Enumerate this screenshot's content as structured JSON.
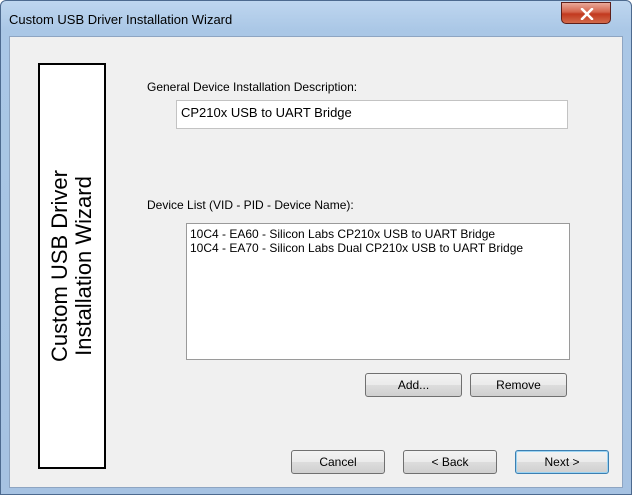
{
  "window": {
    "title": "Custom USB Driver Installation Wizard",
    "close_glyph": "x"
  },
  "side_panel": {
    "line1": "Custom USB Driver",
    "line2": "Installation Wizard"
  },
  "description": {
    "label": "General Device Installation Description:",
    "value": "CP210x USB to UART Bridge"
  },
  "device_list": {
    "label": "Device List (VID - PID - Device Name):",
    "items": [
      "10C4 - EA60 - Silicon Labs CP210x USB to UART Bridge",
      "10C4 - EA70 - Silicon Labs Dual CP210x USB to UART Bridge"
    ]
  },
  "buttons": {
    "add": "Add...",
    "remove": "Remove",
    "cancel": "Cancel",
    "back": "< Back",
    "next": "Next >"
  },
  "colors": {
    "title_bar": "#a9c5e5",
    "close_button": "#c9452a",
    "dialog_background": "#f0f0f0"
  }
}
